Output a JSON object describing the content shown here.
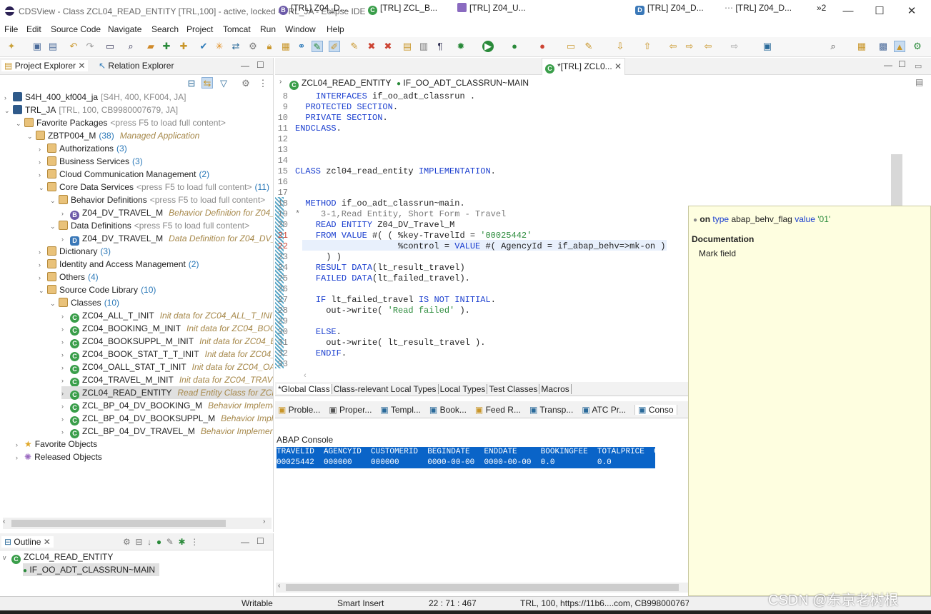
{
  "window": {
    "title": "CDSView - Class ZCL04_READ_ENTITY [TRL,100] - active, locked - TRL_JA - Eclipse IDE"
  },
  "menu": [
    "File",
    "Edit",
    "Source Code",
    "Navigate",
    "Search",
    "Project",
    "Tomcat",
    "Run",
    "Window",
    "Help"
  ],
  "left": {
    "tabs": [
      "Project Explorer",
      "Relation Explorer"
    ]
  },
  "tree": [
    {
      "indent": 0,
      "toggle": ">",
      "icon": "sys",
      "label": "S4H_400_kf004_ja",
      "extra": "[S4H, 400, KF004, JA]"
    },
    {
      "indent": 0,
      "toggle": "v",
      "icon": "sys",
      "label": "TRL_JA",
      "extra": "[TRL, 100, CB9980007679, JA]"
    },
    {
      "indent": 1,
      "toggle": "v",
      "icon": "pkg",
      "label": "Favorite Packages",
      "extra": "<press F5 to load full content>"
    },
    {
      "indent": 2,
      "toggle": "v",
      "icon": "pkg",
      "label": "ZBTP004_M",
      "count": "(38)",
      "note": "Managed Application"
    },
    {
      "indent": 3,
      "toggle": ">",
      "icon": "pkg",
      "label": "Authorizations",
      "count": "(3)"
    },
    {
      "indent": 3,
      "toggle": ">",
      "icon": "pkg",
      "label": "Business Services",
      "count": "(3)"
    },
    {
      "indent": 3,
      "toggle": ">",
      "icon": "pkg",
      "label": "Cloud Communication Management",
      "count": "(2)"
    },
    {
      "indent": 3,
      "toggle": "v",
      "icon": "pkg",
      "label": "Core Data Services",
      "extra": "<press F5 to load full content>",
      "count": "(11)"
    },
    {
      "indent": 4,
      "toggle": "v",
      "icon": "pkg",
      "label": "Behavior Definitions",
      "extra": "<press F5 to load full content>"
    },
    {
      "indent": 5,
      "toggle": ">",
      "icon": "bdef",
      "glyph": "B",
      "label": "Z04_DV_TRAVEL_M",
      "note": "Behavior Definition for Z04_DV_"
    },
    {
      "indent": 4,
      "toggle": "v",
      "icon": "pkg",
      "label": "Data Definitions",
      "extra": "<press F5 to load full content>"
    },
    {
      "indent": 5,
      "toggle": ">",
      "icon": "ddef",
      "glyph": "D",
      "label": "Z04_DV_TRAVEL_M",
      "note": "Data Definition for Z04_DV_T"
    },
    {
      "indent": 3,
      "toggle": ">",
      "icon": "pkg",
      "label": "Dictionary",
      "count": "(3)"
    },
    {
      "indent": 3,
      "toggle": ">",
      "icon": "pkg",
      "label": "Identity and Access Management",
      "count": "(2)"
    },
    {
      "indent": 3,
      "toggle": ">",
      "icon": "pkg",
      "label": "Others",
      "count": "(4)"
    },
    {
      "indent": 3,
      "toggle": "v",
      "icon": "pkg",
      "label": "Source Code Library",
      "count": "(10)"
    },
    {
      "indent": 4,
      "toggle": "v",
      "icon": "pkg",
      "label": "Classes",
      "count": "(10)"
    },
    {
      "indent": 5,
      "toggle": ">",
      "icon": "cls",
      "glyph": "C",
      "label": "ZC04_ALL_T_INIT",
      "note": "Init data for ZC04_ALL_T_INIT"
    },
    {
      "indent": 5,
      "toggle": ">",
      "icon": "cls",
      "glyph": "C",
      "label": "ZC04_BOOKING_M_INIT",
      "note": "Init data for ZC04_BOOK"
    },
    {
      "indent": 5,
      "toggle": ">",
      "icon": "cls",
      "glyph": "C",
      "label": "ZC04_BOOKSUPPL_M_INIT",
      "note": "Init data for ZC04_BO"
    },
    {
      "indent": 5,
      "toggle": ">",
      "icon": "cls",
      "glyph": "C",
      "label": "ZC04_BOOK_STAT_T_T_INIT",
      "note": "Init data for ZC04_BO"
    },
    {
      "indent": 5,
      "toggle": ">",
      "icon": "cls",
      "glyph": "C",
      "label": "ZC04_OALL_STAT_T_INIT",
      "note": "Init data for ZC04_OALL"
    },
    {
      "indent": 5,
      "toggle": ">",
      "icon": "cls",
      "glyph": "C",
      "label": "ZC04_TRAVEL_M_INIT",
      "note": "Init data for ZC04_TRAVEL_"
    },
    {
      "indent": 5,
      "toggle": ">",
      "icon": "cls",
      "glyph": "C",
      "label": "ZCL04_READ_ENTITY",
      "note": "Read Entity Class for ZCL04",
      "selected": true
    },
    {
      "indent": 5,
      "toggle": ">",
      "icon": "cls",
      "glyph": "C",
      "label": "ZCL_BP_04_DV_BOOKING_M",
      "note": "Behavior Implemen"
    },
    {
      "indent": 5,
      "toggle": ">",
      "icon": "cls",
      "glyph": "C",
      "label": "ZCL_BP_04_DV_BOOKSUPPL_M",
      "note": "Behavior Implem"
    },
    {
      "indent": 5,
      "toggle": ">",
      "icon": "cls",
      "glyph": "C",
      "label": "ZCL_BP_04_DV_TRAVEL_M",
      "note": "Behavior Implementat"
    },
    {
      "indent": 1,
      "toggle": ">",
      "icon": "star",
      "label": "Favorite Objects"
    },
    {
      "indent": 1,
      "toggle": ">",
      "icon": "gear",
      "label": "Released Objects"
    }
  ],
  "outline": {
    "title": "Outline",
    "items": [
      "ZCL04_READ_ENTITY",
      "IF_OO_ADT_CLASSRUN~MAIN"
    ]
  },
  "editor": {
    "tabs": [
      "[TRL] Z04_D...",
      "[TRL] ZCL_B...",
      "[TRL] Z04_U...",
      "*[TRL] ZCL0...",
      "[TRL] Z04_D...",
      "[TRL] Z04_D..."
    ],
    "more": "»2",
    "breadcrumb": [
      "ZCL04_READ_ENTITY",
      "IF_OO_ADT_CLASSRUN~MAIN"
    ],
    "lines": [
      {
        "n": "8",
        "t": "    INTERFACES if_oo_adt_classrun ."
      },
      {
        "n": "9",
        "t": "  PROTECTED SECTION."
      },
      {
        "n": "10",
        "t": "  PRIVATE SECTION."
      },
      {
        "n": "11",
        "t": "ENDCLASS."
      },
      {
        "n": "12",
        "t": ""
      },
      {
        "n": "13",
        "t": ""
      },
      {
        "n": "14",
        "t": ""
      },
      {
        "n": "15",
        "t": "CLASS zcl04_read_entity IMPLEMENTATION."
      },
      {
        "n": "16",
        "t": ""
      },
      {
        "n": "17",
        "t": ""
      },
      {
        "n": "18",
        "t": "  METHOD if_oo_adt_classrun~main."
      },
      {
        "n": "19",
        "t": "*    3-1,Read Entity, Short Form - Travel"
      },
      {
        "n": "20",
        "t": "    READ ENTITY Z04_DV_Travel_M"
      },
      {
        "n": "21",
        "t": "    FROM VALUE #( ( %key-TravelId = '00025442'"
      },
      {
        "n": "22",
        "t": "                    %control = VALUE #( AgencyId = if_abap_behv=>mk-on )"
      },
      {
        "n": "23",
        "t": "      ) )"
      },
      {
        "n": "24",
        "t": "    RESULT DATA(lt_result_travel)"
      },
      {
        "n": "25",
        "t": "    FAILED DATA(lt_failed_travel)."
      },
      {
        "n": "26",
        "t": ""
      },
      {
        "n": "27",
        "t": "    IF lt_failed_travel IS NOT INITIAL."
      },
      {
        "n": "28",
        "t": "      out->write( 'Read failed' )."
      },
      {
        "n": "29",
        "t": ""
      },
      {
        "n": "30",
        "t": "    ELSE."
      },
      {
        "n": "31",
        "t": "      out->write( lt_result_travel )."
      },
      {
        "n": "32",
        "t": "    ENDIF."
      },
      {
        "n": "33",
        "t": ""
      }
    ],
    "subtabs": [
      "*Global Class",
      "Class-relevant Local Types",
      "Local Types",
      "Test Classes",
      "Macros"
    ]
  },
  "views": [
    "Proble...",
    "Proper...",
    "Templ...",
    "Book...",
    "Feed R...",
    "Transp...",
    "ATC Pr...",
    "Conso"
  ],
  "console": {
    "title": "ABAP Console",
    "header": "TRAVELID  AGENCYID  CUSTOMERID  BEGINDATE   ENDDATE     BOOKINGFEE  TOTALPRICE  CU",
    "row": "00025442  000000    000000      0000-00-00  0000-00-00  0.0         0.0"
  },
  "popup": {
    "on": "on",
    "type_kw": "type",
    "type_name": "abap_behv_flag",
    "value_kw": "value",
    "value": "'01'",
    "doc_title": "Documentation",
    "doc_text": "Mark field"
  },
  "status": {
    "writable": "Writable",
    "insert": "Smart Insert",
    "pos": "22 : 71 : 467",
    "sys": "TRL, 100, https://11b6....com, CB9980007679, ",
    "watermark": "CSDN @东京老树根"
  },
  "colors": {
    "accent": "#1a3ecf",
    "selection": "#0a64c8",
    "popup_bg": "#fefee0"
  }
}
